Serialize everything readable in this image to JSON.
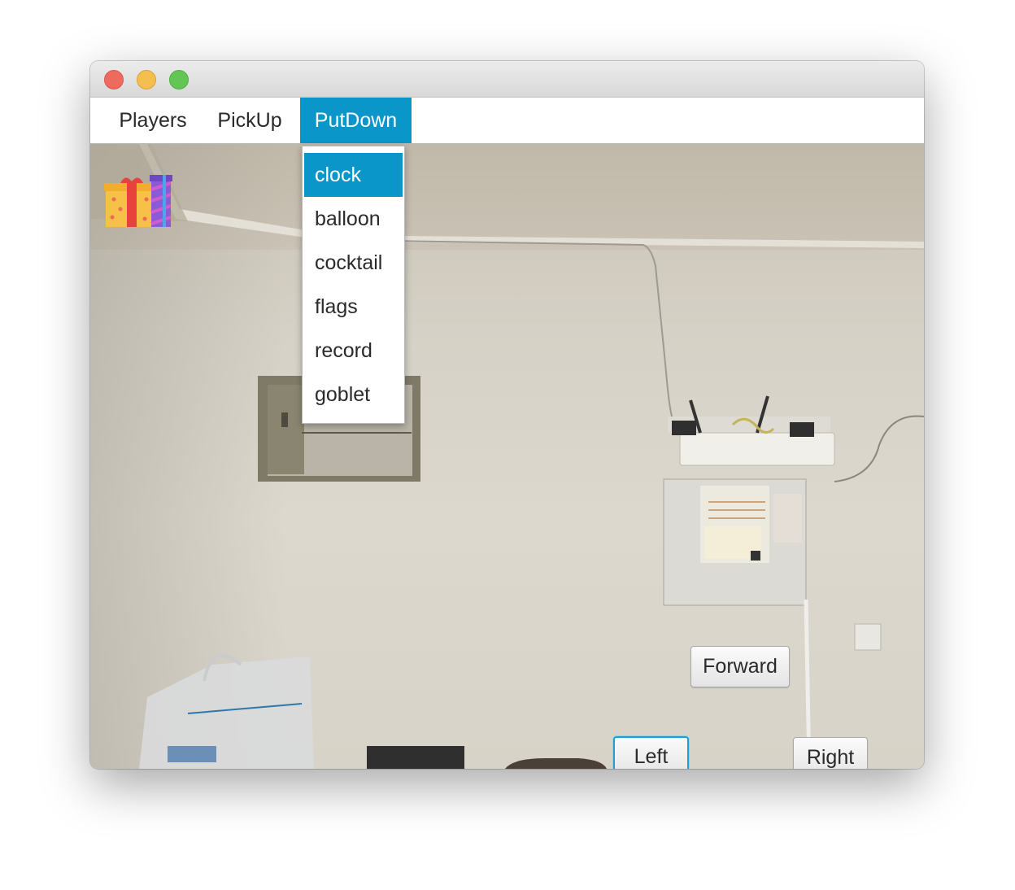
{
  "menubar": {
    "items": [
      {
        "label": "Players"
      },
      {
        "label": "PickUp"
      },
      {
        "label": "PutDown",
        "active": true
      }
    ]
  },
  "dropdown": {
    "items": [
      {
        "label": "clock",
        "selected": true
      },
      {
        "label": "balloon"
      },
      {
        "label": "cocktail"
      },
      {
        "label": "flags"
      },
      {
        "label": "record"
      },
      {
        "label": "goblet"
      }
    ]
  },
  "scene": {
    "item_icon": "gift-icon",
    "buttons": {
      "forward": "Forward",
      "left": "Left",
      "right": "Right"
    }
  },
  "colors": {
    "accent": "#0a96c9",
    "focus_ring": "#1ea0d6"
  }
}
